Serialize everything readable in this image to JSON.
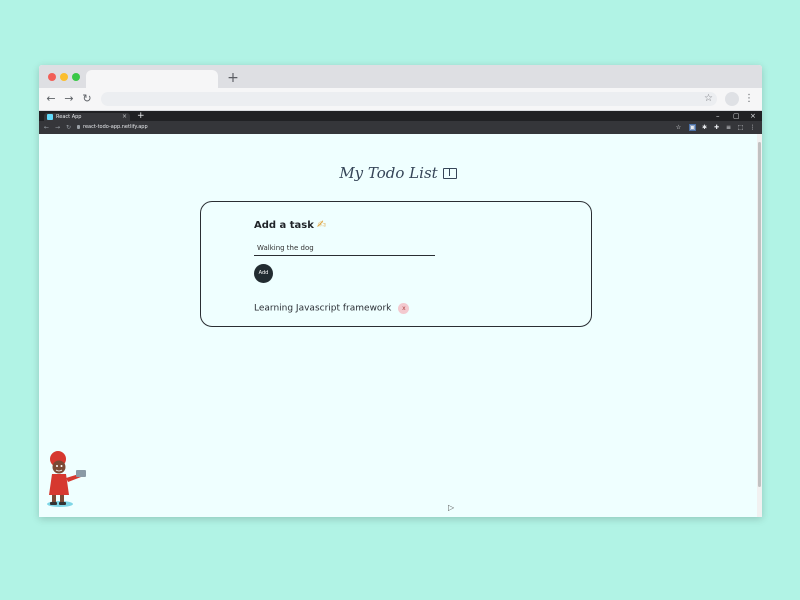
{
  "outer_browser": {
    "new_tab_symbol": "+",
    "nav": {
      "back": "←",
      "forward": "→",
      "reload": "↻"
    },
    "omnibox_star": "☆",
    "menu_symbol": "⋮"
  },
  "inner_browser": {
    "tab_title": "React App",
    "tab_close": "×",
    "new_tab_symbol": "+",
    "window_controls": {
      "minimize": "–",
      "maximize": "▢",
      "close": "×"
    },
    "nav": {
      "back": "←",
      "forward": "→",
      "reload": "↻"
    },
    "url": "react-todo-app.netlify.app",
    "extensions": [
      "☆",
      "▣",
      "✱",
      "✚",
      "≡",
      "⬚",
      "⋮"
    ]
  },
  "app": {
    "title": "My Todo List",
    "title_icon": "book-icon",
    "add_task_label": "Add a task",
    "add_task_icon": "writing-hand-icon",
    "input_value": "Walking the dog",
    "add_button_label": "Add",
    "tasks": [
      {
        "text": "Learning Javascript framework",
        "delete_symbol": "x"
      }
    ]
  },
  "colors": {
    "background": "#b1f3e5",
    "page_background": "#efffff",
    "title_color": "#364558",
    "add_button": "#222c31",
    "delete_button": "#f3c9cf"
  }
}
